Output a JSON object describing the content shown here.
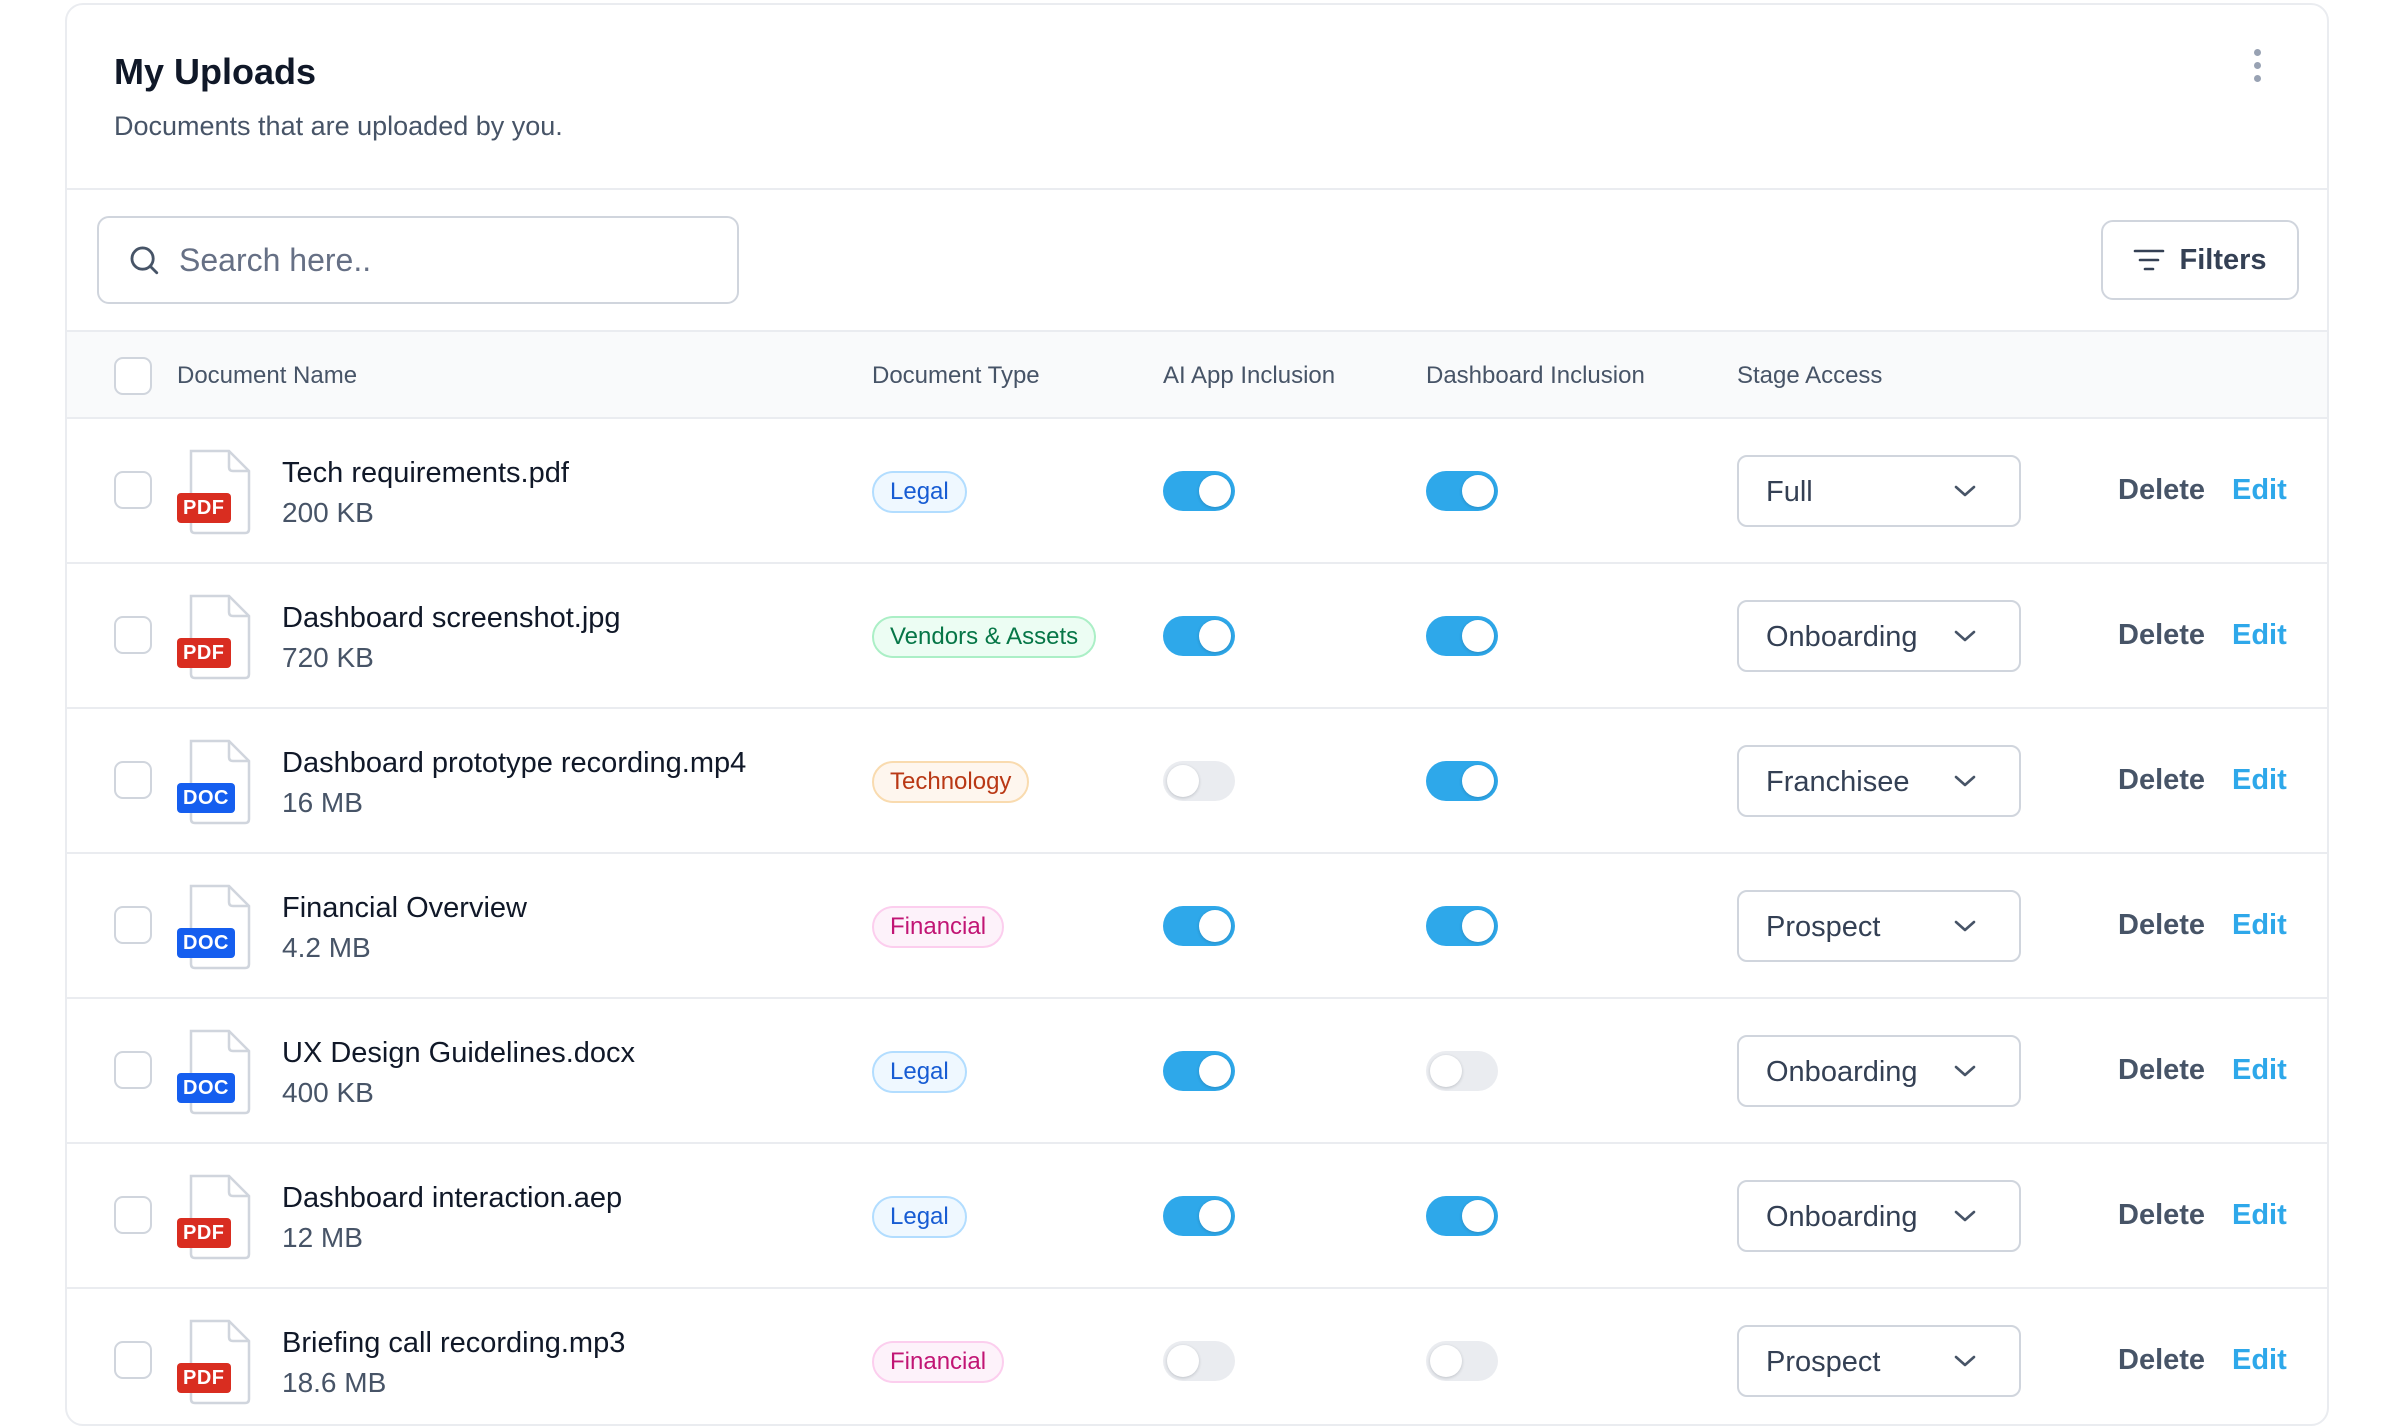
{
  "header": {
    "title": "My Uploads",
    "subtitle": "Documents that are uploaded by you.",
    "menu_icon": "kebab-menu-icon"
  },
  "toolbar": {
    "search_placeholder": "Search here..",
    "filters_label": "Filters"
  },
  "table": {
    "columns": [
      "Document Name",
      "Document Type",
      "AI App Inclusion",
      "Dashboard Inclusion",
      "Stage Access"
    ],
    "delete_label": "Delete",
    "edit_label": "Edit",
    "rows": [
      {
        "name": "Tech requirements.pdf",
        "size": "200 KB",
        "file_tag": "PDF",
        "type": "Legal",
        "ai_inclusion": true,
        "dashboard_inclusion": true,
        "stage": "Full"
      },
      {
        "name": "Dashboard screenshot.jpg",
        "size": "720 KB",
        "file_tag": "PDF",
        "type": "Vendors & Assets",
        "ai_inclusion": true,
        "dashboard_inclusion": true,
        "stage": "Onboarding"
      },
      {
        "name": "Dashboard prototype recording.mp4",
        "size": "16 MB",
        "file_tag": "DOC",
        "type": "Technology",
        "ai_inclusion": false,
        "dashboard_inclusion": true,
        "stage": "Franchisee"
      },
      {
        "name": "Financial Overview",
        "size": "4.2 MB",
        "file_tag": "DOC",
        "type": "Financial",
        "ai_inclusion": true,
        "dashboard_inclusion": true,
        "stage": "Prospect"
      },
      {
        "name": "UX Design Guidelines.docx",
        "size": "400 KB",
        "file_tag": "DOC",
        "type": "Legal",
        "ai_inclusion": true,
        "dashboard_inclusion": false,
        "stage": "Onboarding"
      },
      {
        "name": "Dashboard interaction.aep",
        "size": "12 MB",
        "file_tag": "PDF",
        "type": "Legal",
        "ai_inclusion": true,
        "dashboard_inclusion": true,
        "stage": "Onboarding"
      },
      {
        "name": "Briefing call recording.mp3",
        "size": "18.6 MB",
        "file_tag": "PDF",
        "type": "Financial",
        "ai_inclusion": false,
        "dashboard_inclusion": false,
        "stage": "Prospect"
      }
    ]
  },
  "colors": {
    "accent": "#2ea8ea",
    "pdf_tag": "#d92d20",
    "doc_tag": "#155eef"
  }
}
